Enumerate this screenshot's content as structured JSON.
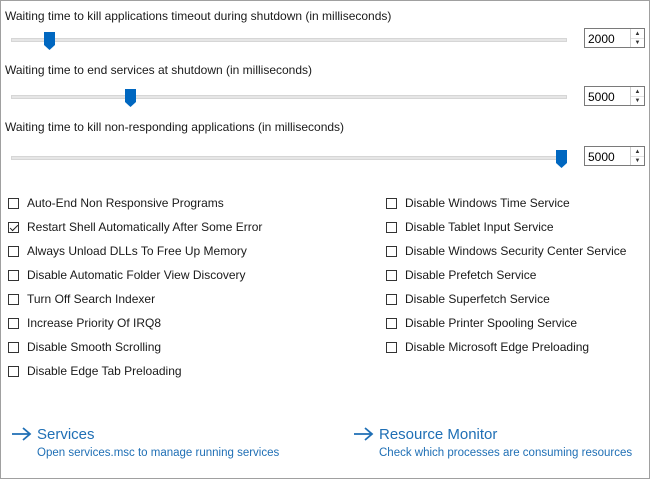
{
  "sliders": [
    {
      "label": "Waiting time to kill applications timeout during shutdown (in milliseconds)",
      "value": "2000",
      "fraction": 0.06
    },
    {
      "label": "Waiting time to end services at shutdown (in milliseconds)",
      "value": "5000",
      "fraction": 0.21
    },
    {
      "label": "Waiting time to kill non-responding applications (in milliseconds)",
      "value": "5000",
      "fraction": 1.0
    }
  ],
  "checkboxes_left": [
    {
      "label": "Auto-End Non Responsive Programs",
      "checked": false
    },
    {
      "label": "Restart Shell Automatically After Some Error",
      "checked": true
    },
    {
      "label": "Always Unload DLLs To Free Up Memory",
      "checked": false
    },
    {
      "label": "Disable Automatic Folder View Discovery",
      "checked": false
    },
    {
      "label": "Turn Off Search Indexer",
      "checked": false
    },
    {
      "label": "Increase Priority Of IRQ8",
      "checked": false
    },
    {
      "label": "Disable Smooth Scrolling",
      "checked": false
    },
    {
      "label": "Disable Edge Tab Preloading",
      "checked": false
    }
  ],
  "checkboxes_right": [
    {
      "label": "Disable Windows Time Service",
      "checked": false
    },
    {
      "label": "Disable Tablet Input Service",
      "checked": false
    },
    {
      "label": "Disable Windows Security Center Service",
      "checked": false
    },
    {
      "label": "Disable Prefetch Service",
      "checked": false
    },
    {
      "label": "Disable Superfetch Service",
      "checked": false
    },
    {
      "label": "Disable Printer Spooling Service",
      "checked": false
    },
    {
      "label": "Disable Microsoft Edge Preloading",
      "checked": false
    }
  ],
  "links": {
    "services": {
      "title": "Services",
      "desc": "Open services.msc to manage running services"
    },
    "resource_monitor": {
      "title": "Resource Monitor",
      "desc": "Check which processes are consuming resources"
    }
  },
  "colors": {
    "accent": "#0067c0",
    "link": "#1f6fb5"
  },
  "icons": {
    "arrow": "arrow-right-icon",
    "spin_up": "chevron-up-icon",
    "spin_down": "chevron-down-icon"
  }
}
